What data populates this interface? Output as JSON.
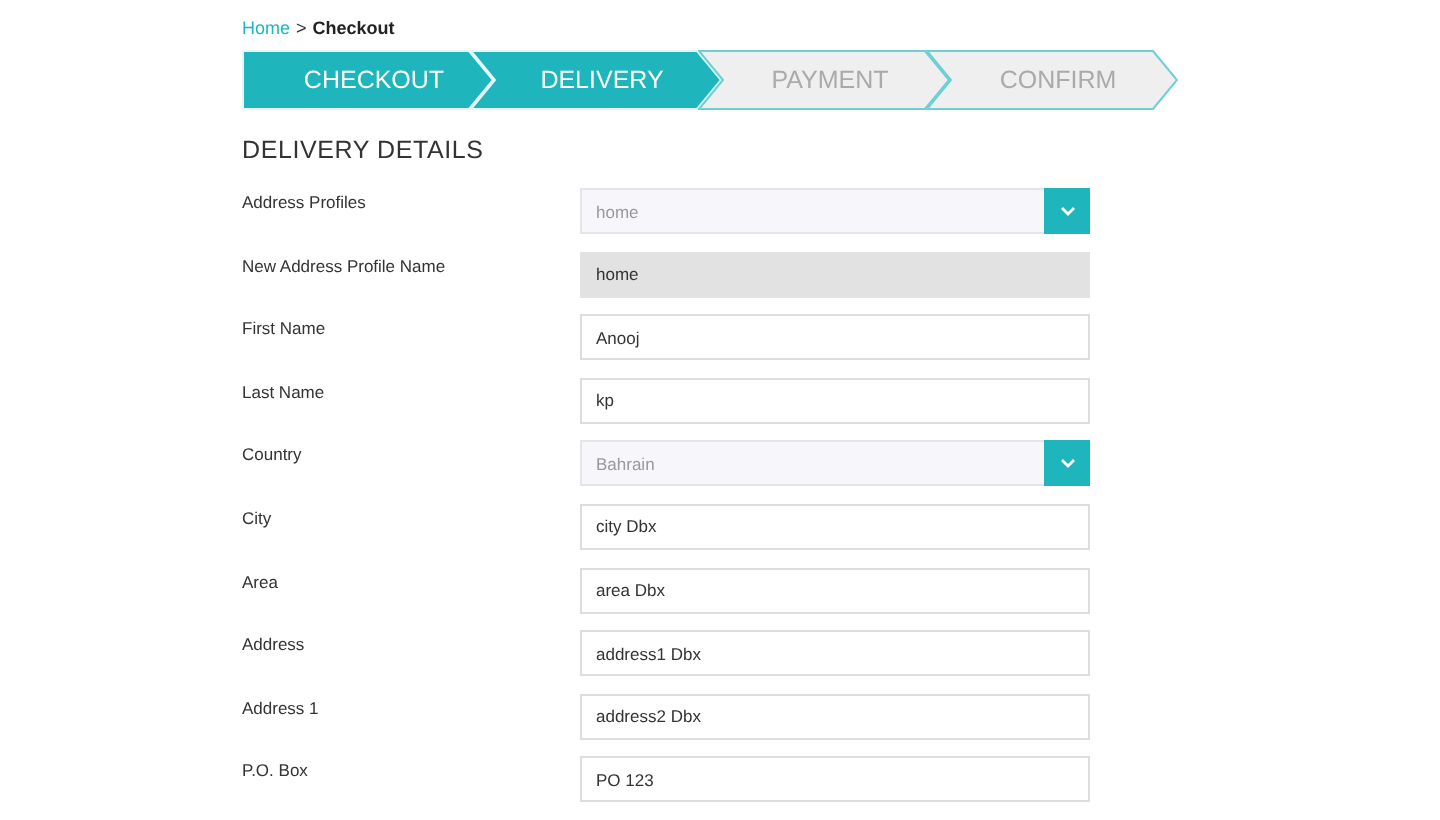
{
  "breadcrumb": {
    "home": "Home",
    "separator": ">",
    "current": "Checkout"
  },
  "steps": [
    {
      "label": "CHECKOUT",
      "active": true
    },
    {
      "label": "DELIVERY",
      "active": true
    },
    {
      "label": "PAYMENT",
      "active": false
    },
    {
      "label": "CONFIRM",
      "active": false
    }
  ],
  "heading": "DELIVERY DETAILS",
  "fields": [
    {
      "label": "Address Profiles",
      "kind": "select",
      "value": "home"
    },
    {
      "label": "New Address Profile Name",
      "kind": "readonly",
      "value": "home"
    },
    {
      "label": "First Name",
      "kind": "text",
      "value": "Anooj"
    },
    {
      "label": "Last Name",
      "kind": "text",
      "value": "kp"
    },
    {
      "label": "Country",
      "kind": "select",
      "value": "Bahrain"
    },
    {
      "label": "City",
      "kind": "text",
      "value": "city Dbx"
    },
    {
      "label": "Area",
      "kind": "text",
      "value": "area Dbx"
    },
    {
      "label": "Address",
      "kind": "text",
      "value": "address1 Dbx"
    },
    {
      "label": "Address 1",
      "kind": "text",
      "value": "address2 Dbx"
    },
    {
      "label": "P.O. Box",
      "kind": "text",
      "value": "PO 123"
    }
  ]
}
